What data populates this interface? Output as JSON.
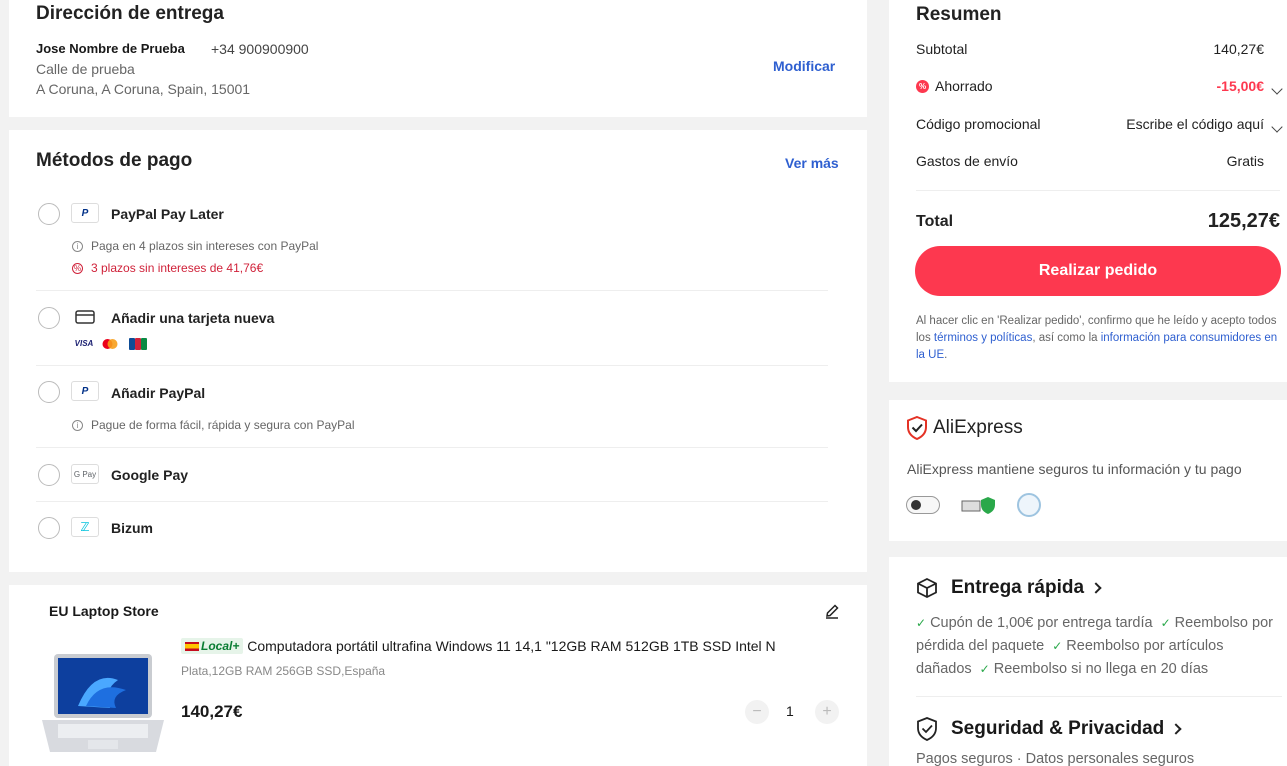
{
  "address": {
    "title": "Dirección de entrega",
    "name": "Jose Nombre de Prueba",
    "phone": "+34 900900900",
    "street": "Calle de prueba",
    "city": "A Coruna, A Coruna, Spain, 15001",
    "edit_label": "Modificar"
  },
  "payment": {
    "title": "Métodos de pago",
    "more_label": "Ver más",
    "methods": [
      {
        "label": "PayPal Pay Later",
        "note1": "Paga en 4 plazos sin intereses con PayPal",
        "note2": "3 plazos sin intereses de 41,76€"
      },
      {
        "label": "Añadir una tarjeta nueva",
        "cards": [
          "VISA",
          "MC",
          "JCB"
        ]
      },
      {
        "label": "Añadir PayPal",
        "note1": "Pague de forma fácil, rápida y segura con PayPal"
      },
      {
        "label": "Google Pay",
        "icon_text": "G Pay"
      },
      {
        "label": "Bizum"
      }
    ]
  },
  "store": {
    "name": "EU Laptop Store",
    "badge": "Local+",
    "product_title": "Computadora portátil ultrafina Windows 11 14,1 \"12GB RAM 512GB 1TB SSD Intel N",
    "variant": "Plata,12GB RAM 256GB SSD,España",
    "price": "140,27€",
    "quantity": "1"
  },
  "summary": {
    "title": "Resumen",
    "subtotal_label": "Subtotal",
    "subtotal_value": "140,27€",
    "saved_label": "Ahorrado",
    "saved_value": "-15,00€",
    "promo_label": "Código promocional",
    "promo_value": "Escribe el código aquí",
    "shipping_label": "Gastos de envío",
    "shipping_value": "Gratis",
    "total_label": "Total",
    "total_value": "125,27€",
    "order_button": "Realizar pedido",
    "terms_part1": "Al hacer clic en 'Realizar pedido', confirmo que he leído y acepto todos los ",
    "terms_link1": "términos y políticas",
    "terms_part2": ", así como la ",
    "terms_link2": "información para consumidores en la UE",
    "terms_end": "."
  },
  "security": {
    "brand": "AliExpress",
    "text": "AliExpress mantiene seguros tu información y tu pago"
  },
  "delivery": {
    "title": "Entrega rápida",
    "item1": "Cupón de 1,00€ por entrega tardía",
    "item2": "Reembolso por pérdida del paquete",
    "item3": "Reembolso por artículos dañados",
    "item4": "Reembolso si no llega en 20 días"
  },
  "privacy": {
    "title": "Seguridad & Privacidad",
    "subtitle": "Pagos seguros · Datos personales seguros"
  },
  "colors": {
    "accent": "#fd384f",
    "link": "#2e5fd0",
    "check": "#2aa84a"
  }
}
